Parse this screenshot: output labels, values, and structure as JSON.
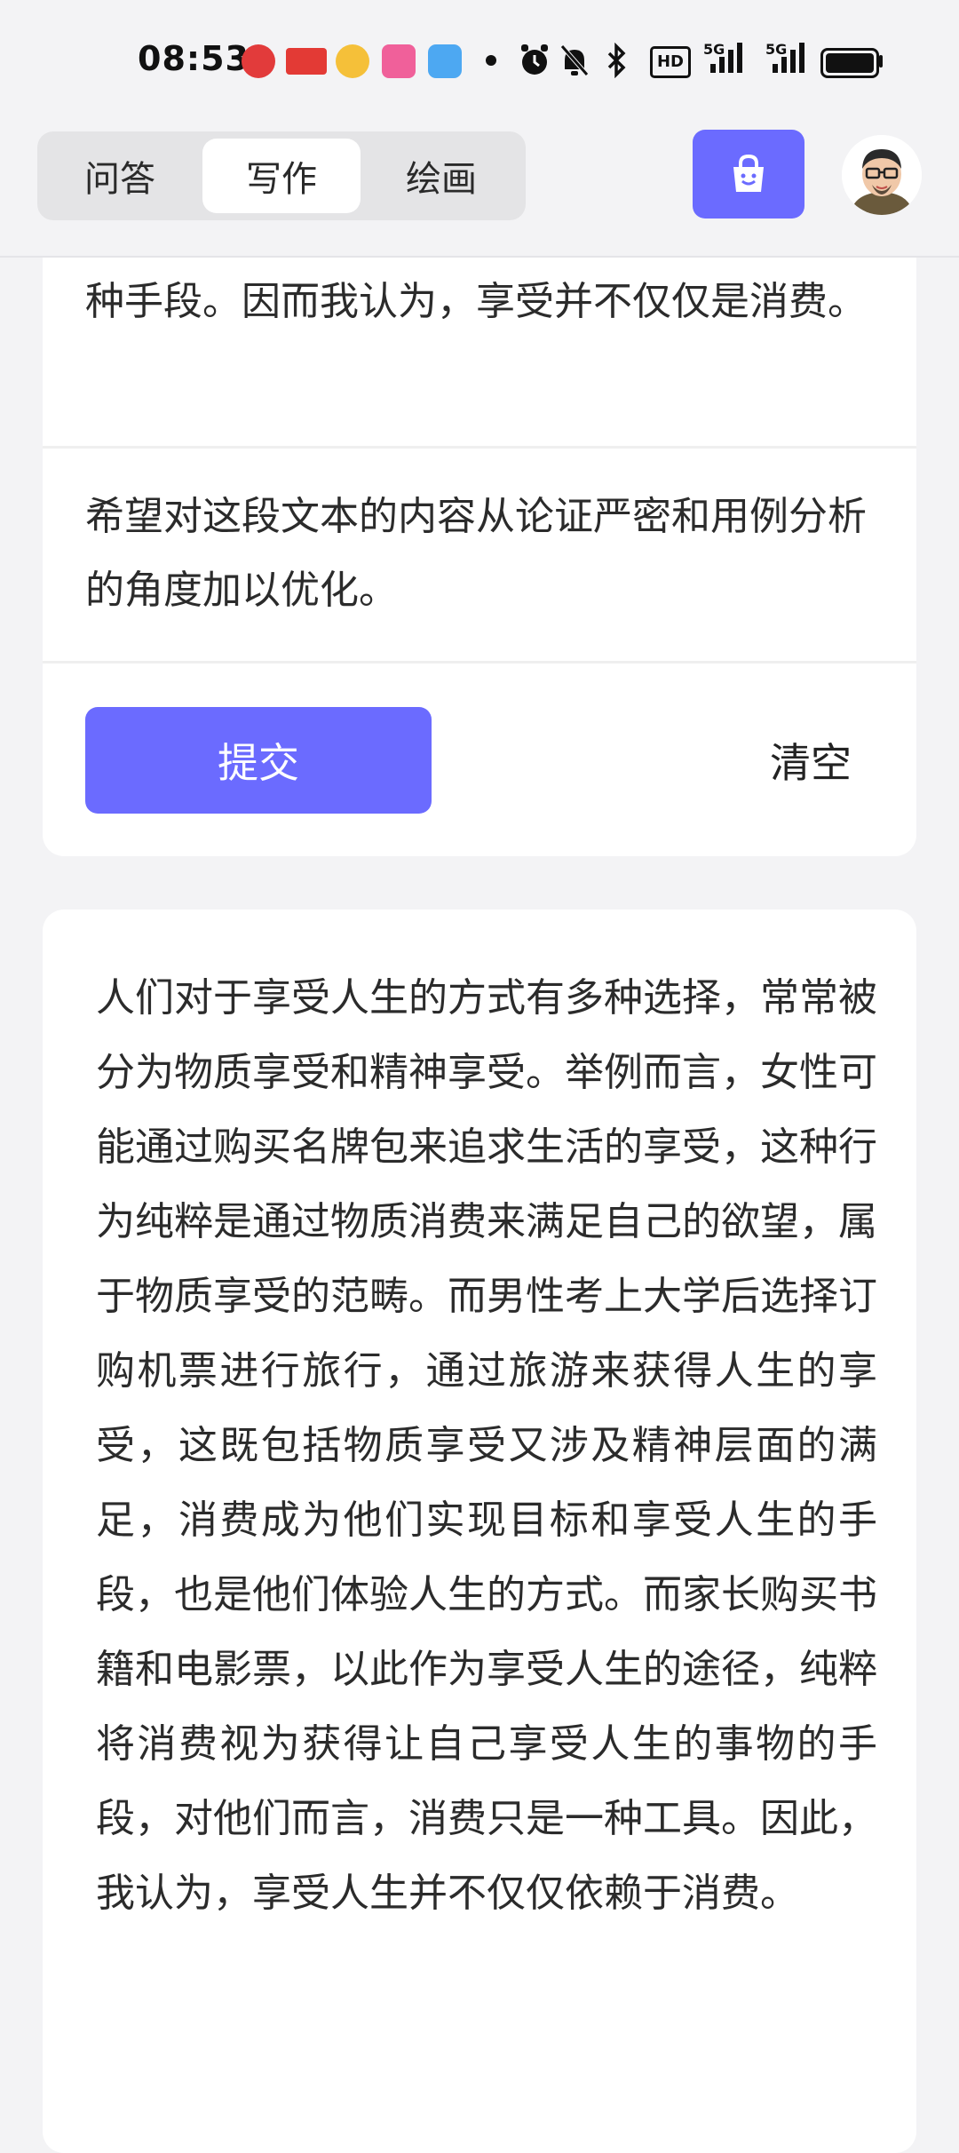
{
  "status_bar": {
    "time": "08:53",
    "network_label_1": "5G",
    "network_label_2": "5G",
    "hd_label": "HD"
  },
  "header": {
    "tabs": [
      {
        "label": "问答",
        "active": false
      },
      {
        "label": "写作",
        "active": true
      },
      {
        "label": "绘画",
        "active": false
      }
    ]
  },
  "input_card": {
    "text_tail": "种手段。因而我认为，享受并不仅仅是消费。",
    "requirement": "希望对这段文本的内容从论证严密和用例分析的角度加以优化。",
    "submit_label": "提交",
    "clear_label": "清空"
  },
  "result_card": {
    "text": "人们对于享受人生的方式有多种选择，常常被分为物质享受和精神享受。举例而言，女性可能通过购买名牌包来追求生活的享受，这种行为纯粹是通过物质消费来满足自己的欲望，属于物质享受的范畴。而男性考上大学后选择订购机票进行旅行，通过旅游来获得人生的享受，这既包括物质享受又涉及精神层面的满足，消费成为他们实现目标和享受人生的手段，也是他们体验人生的方式。而家长购买书籍和电影票，以此作为享受人生的途径，纯粹将消费视为获得让自己享受人生的事物的手段，对他们而言，消费只是一种工具。因此，我认为，享受人生并不仅仅依赖于消费。"
  },
  "colors": {
    "accent": "#6b6bff",
    "background": "#f3f3f5",
    "card": "#ffffff"
  },
  "icons": [
    "shopping-bag-icon",
    "alarm-icon",
    "mute-icon",
    "bluetooth-icon",
    "battery-icon",
    "signal-icon"
  ]
}
